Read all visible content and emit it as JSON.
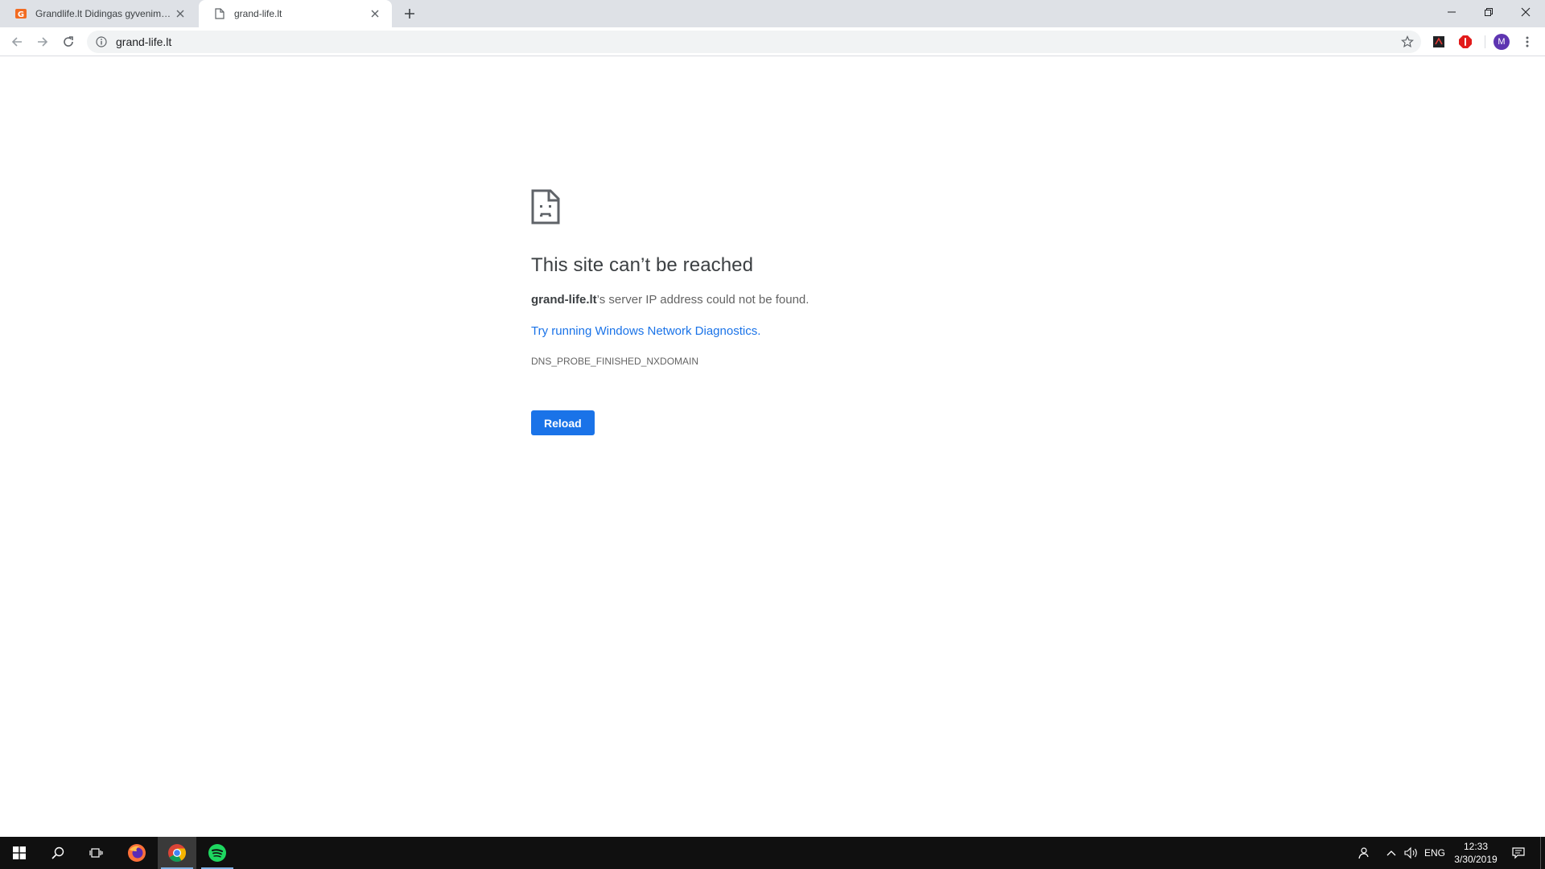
{
  "browser": {
    "tabs": [
      {
        "title": "Grandlife.lt Didingas gyvenimas...",
        "active": false
      },
      {
        "title": "grand-life.lt",
        "active": true
      }
    ],
    "address": "grand-life.lt",
    "avatar_letter": "M"
  },
  "error": {
    "heading": "This site can’t be reached",
    "host": "grand-life.lt",
    "message_suffix": "’s server IP address could not be found.",
    "link": "Try running Windows Network Diagnostics.",
    "code": "DNS_PROBE_FINISHED_NXDOMAIN",
    "reload_label": "Reload"
  },
  "taskbar": {
    "language": "ENG",
    "time": "12:33",
    "date": "3/30/2019"
  },
  "colors": {
    "accent": "#1a73e8",
    "tabstrip": "#dee1e6",
    "taskbar": "#101010"
  }
}
